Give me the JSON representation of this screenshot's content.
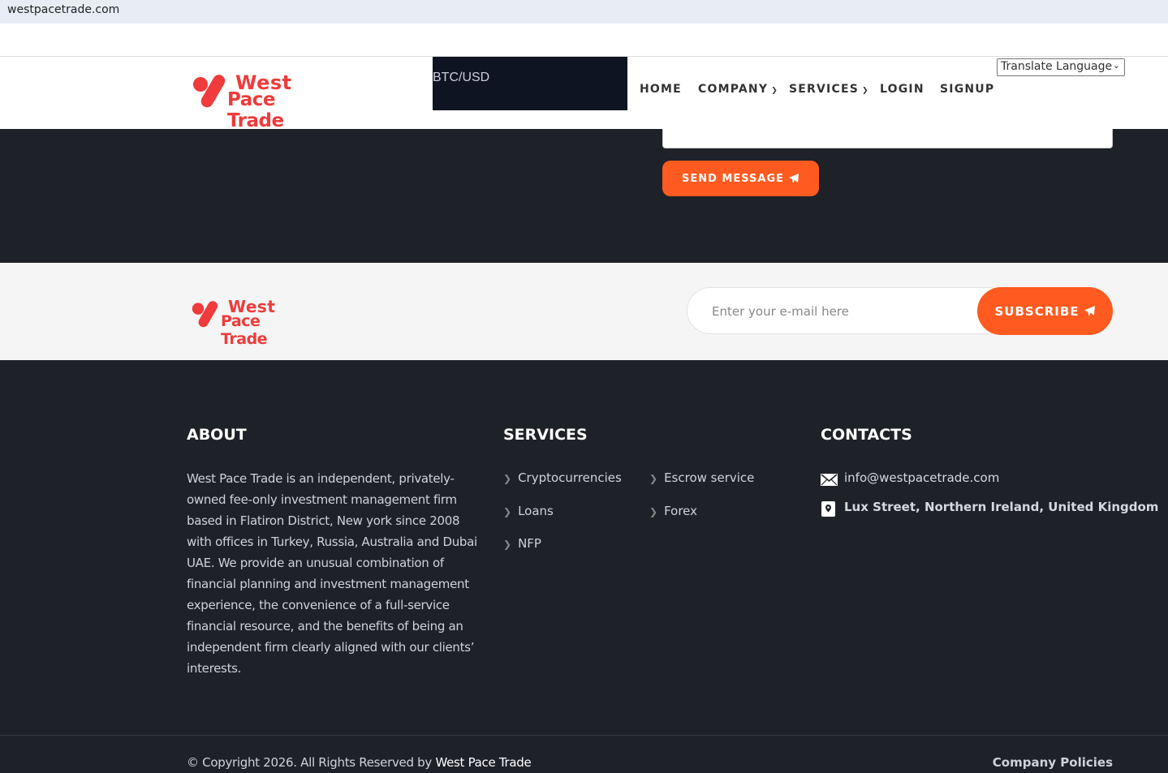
{
  "browser": {
    "url": "westpacetrade.com"
  },
  "brand": {
    "line1": "West",
    "line2": "Pace Trade",
    "color": "#ef3b3b"
  },
  "ticker": {
    "label": "BTC/USD"
  },
  "nav": {
    "items": [
      {
        "label": "HOME"
      },
      {
        "label": "COMPANY",
        "dropdown": true
      },
      {
        "label": "SERVICES",
        "dropdown": true
      },
      {
        "label": "LOGIN"
      },
      {
        "label": "SIGNUP"
      }
    ],
    "translate": "Translate Language"
  },
  "contact_form": {
    "send_label": "SEND MESSAGE"
  },
  "newsletter": {
    "placeholder": "Enter your e-mail here",
    "subscribe_label": "SUBSCRIBE"
  },
  "footer": {
    "about": {
      "title": "ABOUT",
      "text": "West Pace Trade is an independent, privately-owned fee-only investment management firm based in Flatiron District, New york since 2008 with offices in Turkey, Russia, Australia and Dubai UAE. We provide an unusual combination of financial planning and investment management experience, the convenience of a full-service financial resource, and the benefits of being an independent firm clearly aligned with our clients’　interests."
    },
    "services": {
      "title": "SERVICES",
      "items": [
        "Cryptocurrencies",
        "Escrow service",
        "Loans",
        "Forex",
        "NFP"
      ]
    },
    "contacts": {
      "title": "CONTACTS",
      "email": "info@westpacetrade.com",
      "address": "Lux Street, Northern Ireland, United Kingdom"
    },
    "copyright_prefix": "© Copyright 2026. All Rights Reserved by",
    "copyright_brand": "West Pace Trade",
    "policies": "Company Policies"
  },
  "colors": {
    "accent": "#ff5a1f",
    "dark": "#1f2128",
    "ticker_bg": "#0f1422"
  }
}
